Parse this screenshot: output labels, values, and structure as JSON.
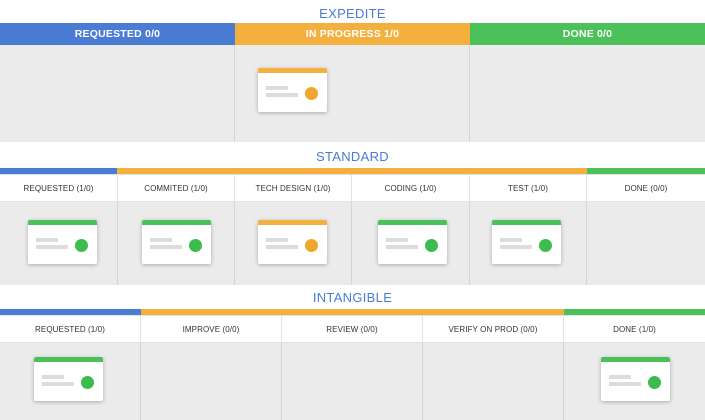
{
  "colors": {
    "blue": "#4a7cd4",
    "orange": "#f3b03e",
    "green": "#4cc159",
    "dot_green": "#3cbc4d",
    "dot_orange": "#f1a630"
  },
  "expedite": {
    "title": "EXPEDITE",
    "columns": [
      {
        "label": "REQUESTED 0/0",
        "color": "blue"
      },
      {
        "label": "IN PROGRESS 1/0",
        "color": "orange"
      },
      {
        "label": "DONE 0/0",
        "color": "green"
      }
    ]
  },
  "standard": {
    "title": "STANDARD",
    "columns": [
      {
        "label": "REQUESTED (1/0)",
        "color": "blue"
      },
      {
        "label": "COMMITED (1/0)",
        "color": "orange"
      },
      {
        "label": "TECH DESIGN (1/0)",
        "color": "orange"
      },
      {
        "label": "CODING (1/0)",
        "color": "orange"
      },
      {
        "label": "TEST (1/0)",
        "color": "orange"
      },
      {
        "label": "DONE (0/0)",
        "color": "green"
      }
    ]
  },
  "intangible": {
    "title": "INTANGIBLE",
    "columns": [
      {
        "label": "REQUESTED (1/0)",
        "color": "blue"
      },
      {
        "label": "IMPROVE (0/0)",
        "color": "orange"
      },
      {
        "label": "REVIEW (0/0)",
        "color": "orange"
      },
      {
        "label": "VERIFY ON PROD (0/0)",
        "color": "orange"
      },
      {
        "label": "DONE (1/0)",
        "color": "green"
      }
    ]
  }
}
